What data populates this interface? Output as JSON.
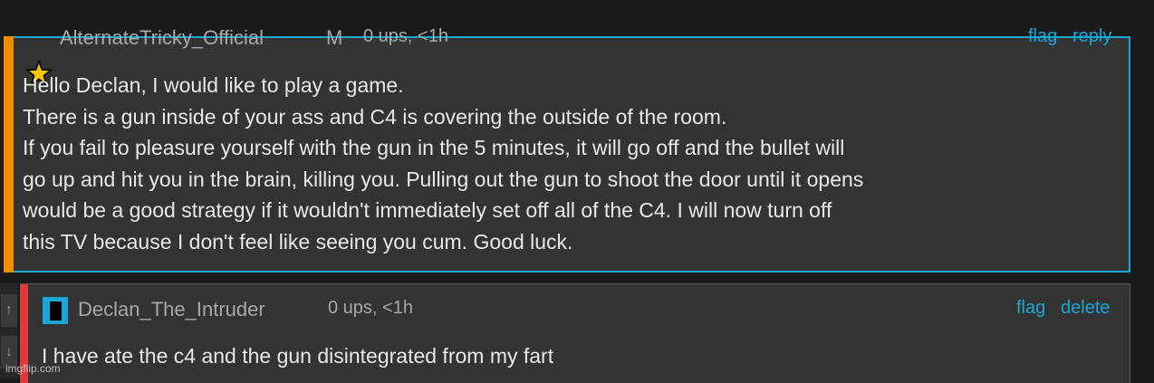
{
  "comments": [
    {
      "username": "AlternateTricky_Official",
      "rank_badge": "M",
      "meta": "0 ups, <1h",
      "actions": [
        "flag",
        "reply"
      ],
      "text": "Hello Declan, I would like to play a game.\nThere is a gun inside of your ass and C4 is covering the outside of the room.\nIf you fail to pleasure yourself with the gun in the 5 minutes, it will go off and the bullet will\ngo up and hit you in the brain, killing you. Pulling out the gun to shoot the door until it opens\nwould be a good strategy if it wouldn't immediately set off all of the C4. I will now turn off\nthis TV because I don't feel like seeing you cum. Good luck.",
      "accent_color": "#f08c00",
      "avatar_icon": "star-icon"
    },
    {
      "username": "Declan_The_Intruder",
      "meta": "0 ups, <1h",
      "actions": [
        "flag",
        "delete"
      ],
      "text": "I have ate the c4 and the gun disintegrated from my fart",
      "accent_color": "#e23a3a",
      "avatar_icon": "flag-icon"
    }
  ],
  "vote_arrows": [
    "up-arrow-icon",
    "down-arrow-icon"
  ],
  "watermark": "imgflip.com",
  "colors": {
    "link": "#1aa7d6",
    "background": "#333333"
  }
}
